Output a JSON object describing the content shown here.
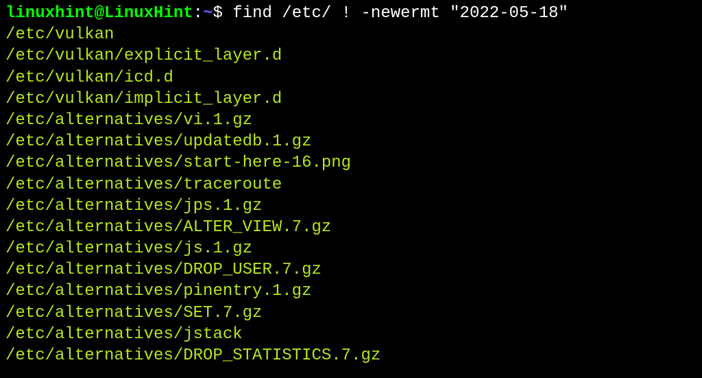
{
  "prompt": {
    "user_host": "linuxhint@LinuxHint",
    "colon": ":",
    "path": "~",
    "dollar": "$ ",
    "command": "find /etc/ ! -newermt \"2022-05-18\""
  },
  "output": [
    "/etc/vulkan",
    "/etc/vulkan/explicit_layer.d",
    "/etc/vulkan/icd.d",
    "/etc/vulkan/implicit_layer.d",
    "/etc/alternatives/vi.1.gz",
    "/etc/alternatives/updatedb.1.gz",
    "/etc/alternatives/start-here-16.png",
    "/etc/alternatives/traceroute",
    "/etc/alternatives/jps.1.gz",
    "/etc/alternatives/ALTER_VIEW.7.gz",
    "/etc/alternatives/js.1.gz",
    "/etc/alternatives/DROP_USER.7.gz",
    "/etc/alternatives/pinentry.1.gz",
    "/etc/alternatives/SET.7.gz",
    "/etc/alternatives/jstack",
    "/etc/alternatives/DROP_STATISTICS.7.gz"
  ]
}
